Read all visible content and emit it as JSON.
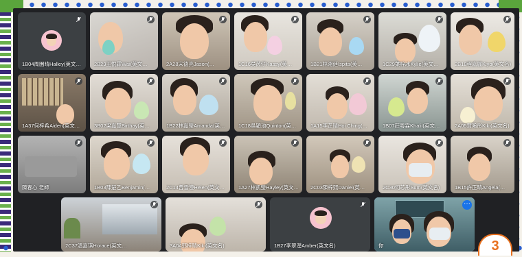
{
  "page_number": "3",
  "self_label": "你",
  "tiles": [
    {
      "name": "1B04周園晴Halley(英文…"
    },
    {
      "name": "2B29王悅霖Wai(英文…"
    },
    {
      "name": "2A28宋德亮Jason(…"
    },
    {
      "name": "1C16吳芮仔Kassy(英…"
    },
    {
      "name": "1B21林湘廷Ispita(英…"
    },
    {
      "name": "1C29葉梓冰Kylie(英文…"
    },
    {
      "name": "2B18程嘉麗Kiyo(英文名)"
    },
    {
      "name": "1A37何梓希Aiden(英文…"
    },
    {
      "name": "3B02梁嘉慧Birthay(英…"
    },
    {
      "name": "1B22林嘉瑩Amanda(英…"
    },
    {
      "name": "1C18吳穎池Quinton(英文…"
    },
    {
      "name": "1A15李芷晴Hoi Ching(…"
    },
    {
      "name": "1B07莊粤霖Khalil(英文…"
    },
    {
      "name": "2A05賀晞彤Kiki(英文名)"
    },
    {
      "name": "陳春心 老師"
    },
    {
      "name": "1B03陳楚乙Benjamin(…"
    },
    {
      "name": "2C14曾雪瀅Helen(英文…"
    },
    {
      "name": "1A27林凱瑩Hayley(英文…"
    },
    {
      "name": "2C03陳梓熙Daniel(英…"
    },
    {
      "name": "2C30何芯彤Sum(英文名)"
    },
    {
      "name": "1B15許正晴Angela(…"
    },
    {
      "name": "2C37溫嘉琪Horace(英文…"
    },
    {
      "name": "3A04郭梓晴Kiki(英文名)"
    },
    {
      "name": "1B27李翠瀅Amber(英文名)"
    },
    {
      "name": "你"
    }
  ]
}
